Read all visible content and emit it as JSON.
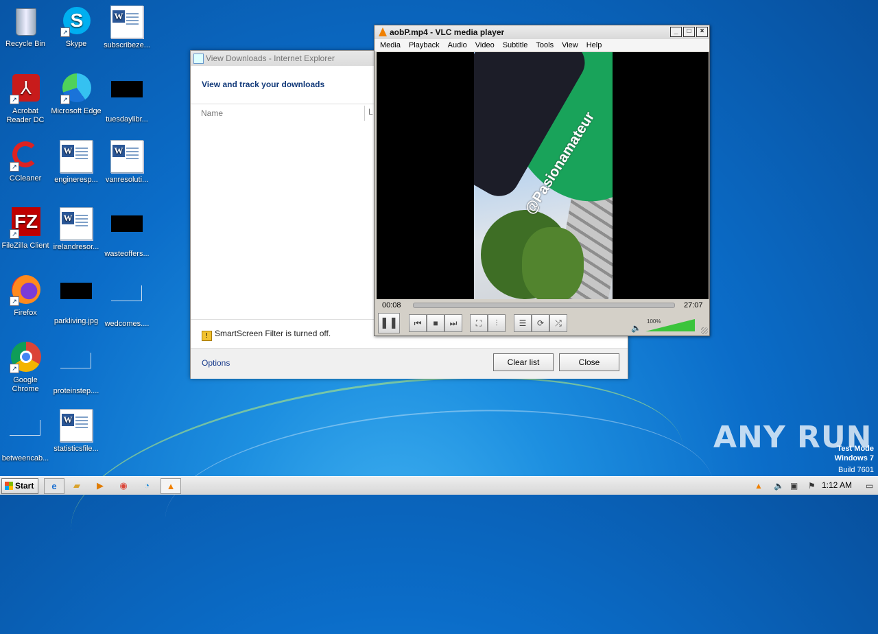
{
  "desktop": {
    "icons": [
      {
        "label": "Recycle Bin"
      },
      {
        "label": "Skype"
      },
      {
        "label": "subscribeze..."
      },
      {
        "label": "Acrobat Reader DC"
      },
      {
        "label": "Microsoft Edge"
      },
      {
        "label": "tuesdaylibr..."
      },
      {
        "label": "CCleaner"
      },
      {
        "label": "engineresp..."
      },
      {
        "label": "vanresoluti..."
      },
      {
        "label": "FileZilla Client"
      },
      {
        "label": "irelandresor..."
      },
      {
        "label": "wasteoffers..."
      },
      {
        "label": "Firefox"
      },
      {
        "label": "parkliving.jpg"
      },
      {
        "label": "wedcomes...."
      },
      {
        "label": "Google Chrome"
      },
      {
        "label": "proteinstep...."
      },
      {
        "label": "betweencab..."
      },
      {
        "label": "statisticsfile..."
      }
    ],
    "watermark": {
      "brand": "ANY RUN",
      "mode": "Test Mode",
      "os": "Windows 7",
      "build": "Build 7601"
    }
  },
  "ie_downloads": {
    "title": "View Downloads - Internet Explorer",
    "heading": "View and track your downloads",
    "column_name": "Name",
    "column_l": "L",
    "smartscreen": "SmartScreen Filter is turned off.",
    "options_link": "Options",
    "clear_button": "Clear list",
    "close_button": "Close"
  },
  "vlc": {
    "title": "aobP.mp4 - VLC media player",
    "menu": [
      "Media",
      "Playback",
      "Audio",
      "Video",
      "Subtitle",
      "Tools",
      "View",
      "Help"
    ],
    "video_watermark": "@Pasionamateur",
    "elapsed": "00:08",
    "total": "27:07",
    "volume_label": "100%",
    "volume_level": 1.0,
    "progress_fraction": 0.005,
    "window_buttons": [
      "_",
      "□",
      "×"
    ],
    "accent_color": "#f08000"
  },
  "taskbar": {
    "start_label": "Start",
    "clock": "1:12 AM",
    "apps": [
      "internet-explorer-icon",
      "explorer-icon",
      "media-player-icon",
      "chrome-icon",
      "edge-icon",
      "vlc-icon"
    ]
  }
}
